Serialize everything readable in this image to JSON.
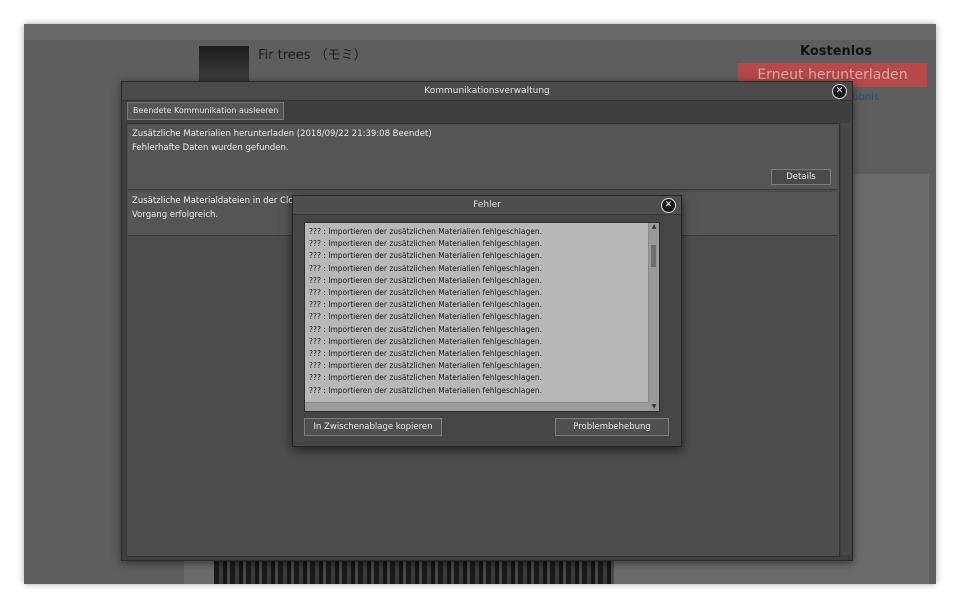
{
  "background": {
    "title": "Fir trees （モミ）",
    "price_label": "Kostenlos",
    "redownload_label": "Erneut herunterladen",
    "license_label": "aubnis"
  },
  "comm_dialog": {
    "title": "Kommunikationsverwaltung",
    "clear_button": "Beendete Kommunikation ausleeren",
    "items": [
      {
        "line1": "Zusätzliche Materialien herunterladen (2018/09/22 21:39:08 Beendet)",
        "line2": "Fehlerhafte Daten wurden gefunden.",
        "details_label": "Details"
      },
      {
        "line1": "Zusätzliche Materialdateien in der Cloud",
        "line2": "Vorgang erfolgreich."
      }
    ]
  },
  "error_dialog": {
    "title": "Fehler",
    "rows": [
      "??? : Importieren der zusätzlichen Materialien fehlgeschlagen.",
      "??? : Importieren der zusätzlichen Materialien fehlgeschlagen.",
      "??? : Importieren der zusätzlichen Materialien fehlgeschlagen.",
      "??? : Importieren der zusätzlichen Materialien fehlgeschlagen.",
      "??? : Importieren der zusätzlichen Materialien fehlgeschlagen.",
      "??? : Importieren der zusätzlichen Materialien fehlgeschlagen.",
      "??? : Importieren der zusätzlichen Materialien fehlgeschlagen.",
      "??? : Importieren der zusätzlichen Materialien fehlgeschlagen.",
      "??? : Importieren der zusätzlichen Materialien fehlgeschlagen.",
      "??? : Importieren der zusätzlichen Materialien fehlgeschlagen.",
      "??? : Importieren der zusätzlichen Materialien fehlgeschlagen.",
      "??? : Importieren der zusätzlichen Materialien fehlgeschlagen.",
      "??? : Importieren der zusätzlichen Materialien fehlgeschlagen.",
      "??? : Importieren der zusätzlichen Materialien fehlgeschlagen."
    ],
    "copy_button": "In Zwischenablage kopieren",
    "troubleshoot_button": "Problembehebung"
  },
  "colors": {
    "overlay": "#5e5e5e",
    "redownload_button": "#b54848",
    "error_list_bg": "#b8b8b8"
  }
}
